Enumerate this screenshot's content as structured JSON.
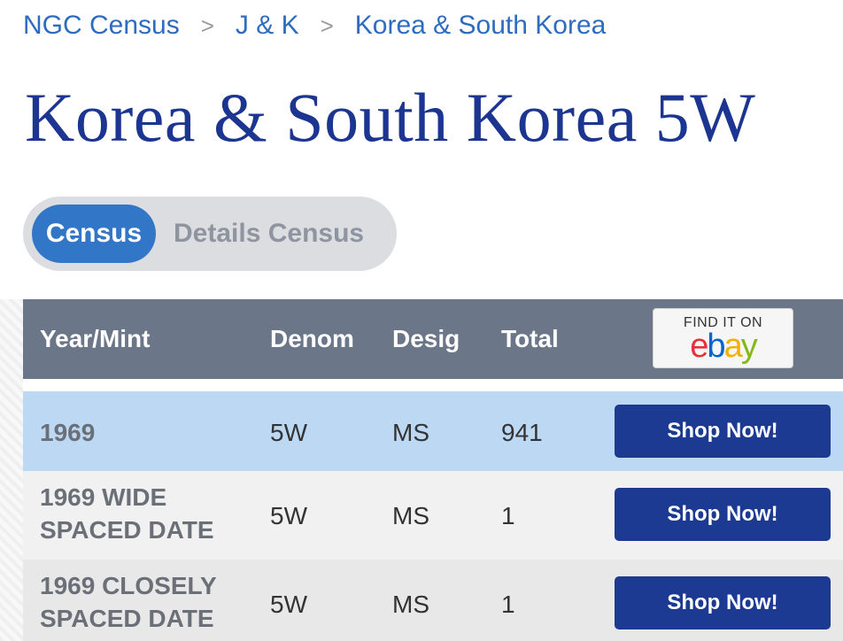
{
  "breadcrumb": [
    "NGC Census",
    "J & K",
    "Korea & South Korea"
  ],
  "breadcrumb_separator": ">",
  "title": "Korea & South Korea 5W",
  "toggle": {
    "active": "Census",
    "inactive": "Details Census"
  },
  "table": {
    "headers": {
      "year": "Year/Mint",
      "denom": "Denom",
      "desig": "Desig",
      "total": "Total"
    },
    "ebay": {
      "find_text": "FIND IT ON",
      "logo_letters": [
        "e",
        "b",
        "a",
        "y"
      ],
      "logo_colors": [
        "#e53238",
        "#0064d2",
        "#f5af02",
        "#86b817"
      ]
    },
    "rows": [
      {
        "year_lines": [
          "1969"
        ],
        "denom": "5W",
        "desig": "MS",
        "total": "941",
        "button": "Shop Now!",
        "highlighted": true
      },
      {
        "year_lines": [
          "1969 WIDE",
          "SPACED DATE"
        ],
        "denom": "5W",
        "desig": "MS",
        "total": "1",
        "button": "Shop Now!",
        "highlighted": false
      },
      {
        "year_lines": [
          "1969 CLOSELY",
          "SPACED DATE"
        ],
        "denom": "5W",
        "desig": "MS",
        "total": "1",
        "button": "Shop Now!",
        "highlighted": false
      }
    ]
  },
  "colors": {
    "link": "#2d6cc0",
    "title": "#1b3590",
    "toggle_active": "#3276c8",
    "header_bg": "#6c7689",
    "button_bg": "#1c3a92",
    "highlight_row": "#bcd8f3"
  }
}
